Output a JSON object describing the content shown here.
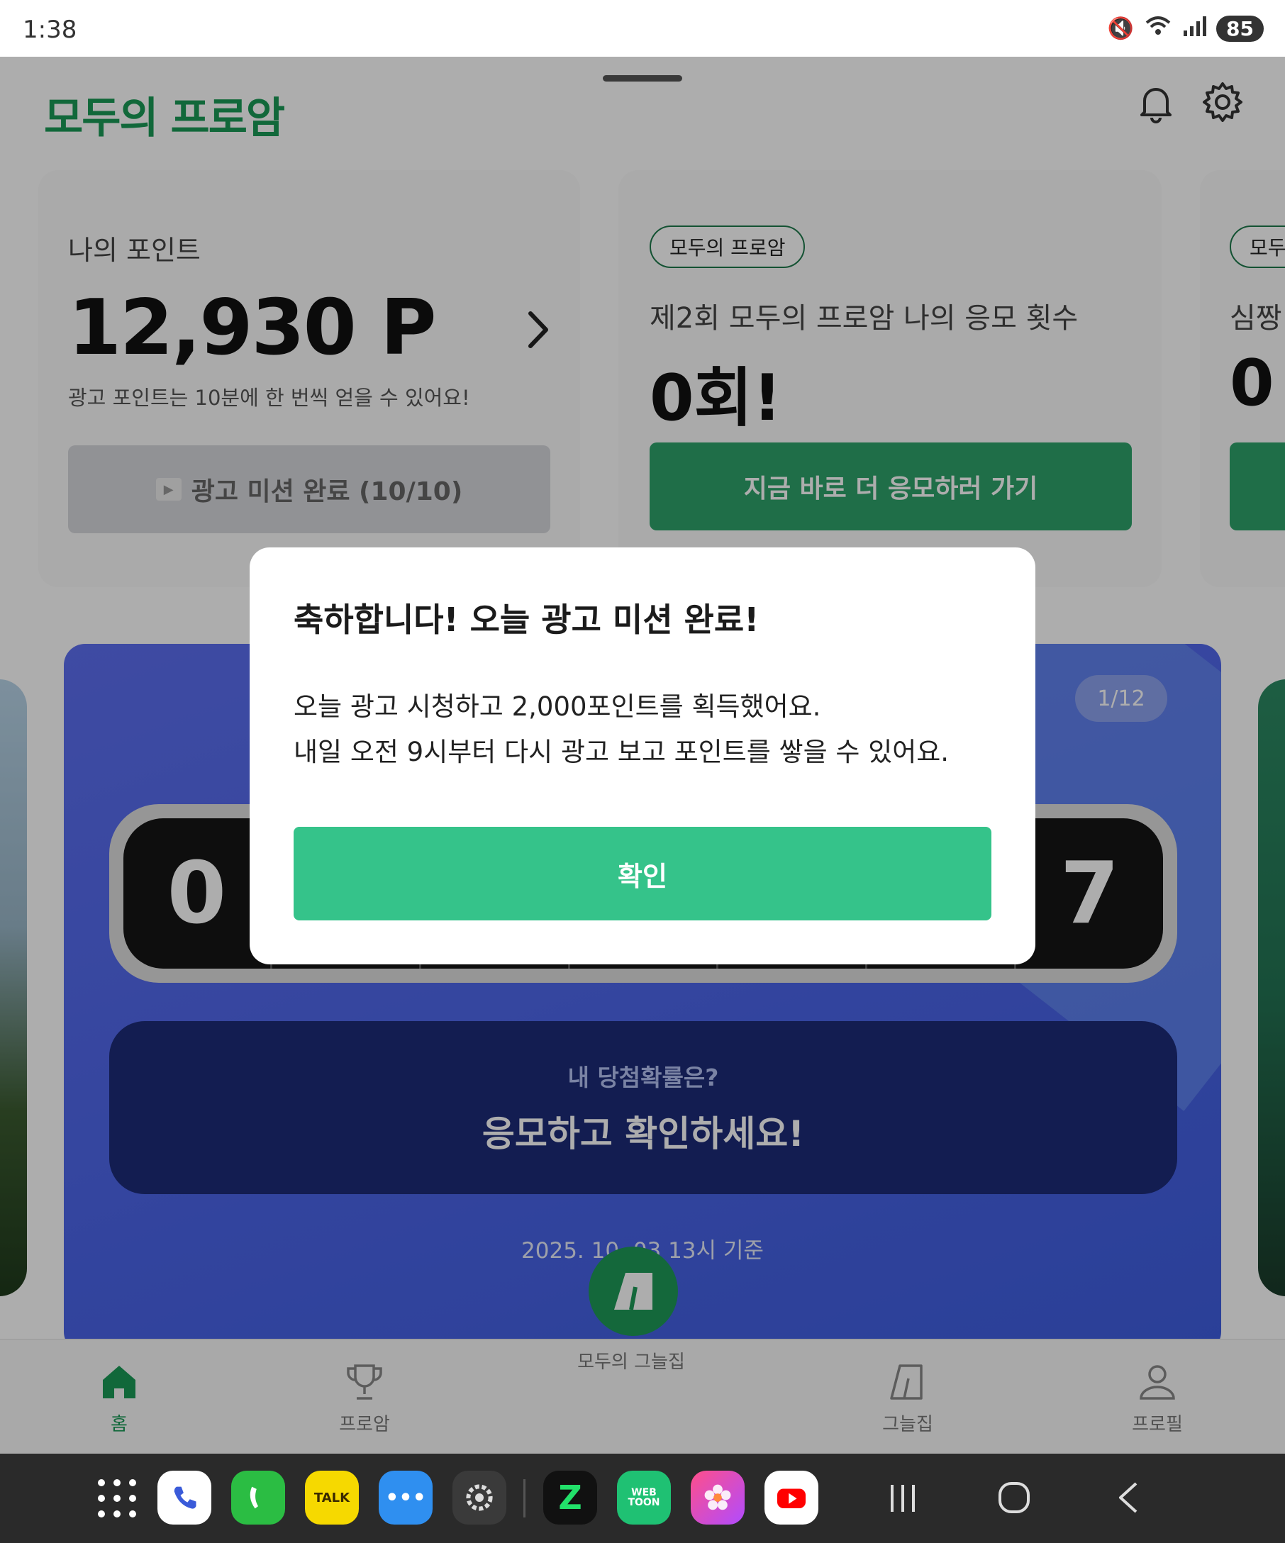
{
  "status_bar": {
    "time": "1:38",
    "battery": "85"
  },
  "header": {
    "logo": "모두의 프로암"
  },
  "points_card": {
    "label": "나의 포인트",
    "value": "12,930 P",
    "note": "광고 포인트는 10분에 한 번씩 얻을 수 있어요!",
    "ad_button": "광고 미션 완료 (10/10)"
  },
  "entries_card": {
    "tag": "모두의 프로암",
    "label": "제2회 모두의 프로암 나의 응모 횟수",
    "value": "0회!",
    "button": "지금 바로 더 응모하러 가기"
  },
  "third_card": {
    "tag": "모두",
    "label": "심짱",
    "value": "0"
  },
  "banner": {
    "digits": [
      "0",
      "",
      "",
      "",
      "",
      "",
      "7"
    ],
    "chance_question": "내 당첨확률은?",
    "chance_cta": "응모하고 확인하세요!",
    "date": "2025. 10. 03 13시 기준",
    "page_indicator": "1/12"
  },
  "bottom_nav": {
    "home": "홈",
    "proam": "프로암",
    "center": "모두의 그늘집",
    "shade": "그늘집",
    "profile": "프로필"
  },
  "dialog": {
    "title": "축하합니다! 오늘 광고 미션 완료!",
    "line1": "오늘 광고 시청하고 2,000포인트를 획득했어요.",
    "line2": "내일 오전 9시부터 다시 광고 보고 포인트를 쌓을 수 있어요.",
    "confirm": "확인"
  },
  "dock": {
    "apps": [
      "phone-icon",
      "call-icon",
      "kakaotalk-icon",
      "messages-icon",
      "settings-icon",
      "zigzag-icon",
      "webtoon-icon",
      "gallery-icon",
      "youtube-icon"
    ],
    "kakaotalk_label": "TALK",
    "webtoon_label": "WEB TOON"
  }
}
